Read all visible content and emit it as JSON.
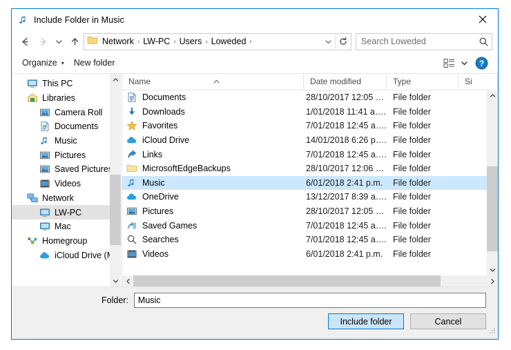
{
  "window": {
    "title": "Include Folder in Music",
    "title_icon": "music-note-icon",
    "close_label": "✕"
  },
  "nav": {
    "back_icon": "←",
    "forward_icon": "→",
    "recent_icon": "⌄",
    "up_icon": "↑",
    "breadcrumbs": [
      "Network",
      "LW-PC",
      "Users",
      "Loweded"
    ],
    "separator": "›",
    "dropdown_icon": "⌄",
    "refresh_icon": "↻"
  },
  "search": {
    "placeholder": "Search Loweded",
    "icon": "search-icon"
  },
  "toolbar": {
    "organize_label": "Organize",
    "organize_caret": "▾",
    "new_folder_label": "New folder",
    "view_icon": "view-list-icon",
    "view_caret": "▾",
    "help_label": "?"
  },
  "sidebar": {
    "items": [
      {
        "label": "This PC",
        "icon": "monitor-icon",
        "depth": 0,
        "selected": false
      },
      {
        "label": "Libraries",
        "icon": "library-icon",
        "depth": 0,
        "selected": false
      },
      {
        "label": "Camera Roll",
        "icon": "camera-roll-icon",
        "depth": 1,
        "selected": false
      },
      {
        "label": "Documents",
        "icon": "documents-icon",
        "depth": 1,
        "selected": false
      },
      {
        "label": "Music",
        "icon": "music-note-icon",
        "depth": 1,
        "selected": false
      },
      {
        "label": "Pictures",
        "icon": "pictures-icon",
        "depth": 1,
        "selected": false
      },
      {
        "label": "Saved Pictures",
        "icon": "saved-pictures-icon",
        "depth": 1,
        "selected": false
      },
      {
        "label": "Videos",
        "icon": "videos-icon",
        "depth": 1,
        "selected": false
      },
      {
        "label": "Network",
        "icon": "network-icon",
        "depth": 0,
        "selected": false
      },
      {
        "label": "LW-PC",
        "icon": "computer-icon",
        "depth": 1,
        "selected": true
      },
      {
        "label": "Mac",
        "icon": "computer-icon",
        "depth": 1,
        "selected": false
      },
      {
        "label": "Homegroup",
        "icon": "homegroup-icon",
        "depth": 0,
        "selected": false
      },
      {
        "label": "iCloud Drive (M·",
        "icon": "icloud-icon",
        "depth": 1,
        "selected": false
      }
    ],
    "scroll_up_icon": "⌃",
    "scroll_down_icon": "⌄"
  },
  "filelist": {
    "columns": [
      {
        "label": "Name",
        "sorted": true,
        "sort_caret": "⌃"
      },
      {
        "label": "Date modified",
        "sorted": false
      },
      {
        "label": "Type",
        "sorted": false
      },
      {
        "label": "Si",
        "sorted": false
      }
    ],
    "rows": [
      {
        "name": "Documents",
        "icon": "documents-icon",
        "date": "28/10/2017 12:05 …",
        "type": "File folder",
        "selected": false
      },
      {
        "name": "Downloads",
        "icon": "downloads-icon",
        "date": "1/01/2018 11:41 a….",
        "type": "File folder",
        "selected": false
      },
      {
        "name": "Favorites",
        "icon": "star-icon",
        "date": "7/01/2018 12:45 a….",
        "type": "File folder",
        "selected": false
      },
      {
        "name": "iCloud Drive",
        "icon": "icloud-icon",
        "date": "14/01/2018 6:26 p….",
        "type": "File folder",
        "selected": false
      },
      {
        "name": "Links",
        "icon": "links-icon",
        "date": "7/01/2018 12:45 a….",
        "type": "File folder",
        "selected": false
      },
      {
        "name": "MicrosoftEdgeBackups",
        "icon": "folder-icon",
        "date": "28/10/2017 12:06 …",
        "type": "File folder",
        "selected": false
      },
      {
        "name": "Music",
        "icon": "music-note-icon",
        "date": "6/01/2018 2:41 p.m.",
        "type": "File folder",
        "selected": true
      },
      {
        "name": "OneDrive",
        "icon": "onedrive-icon",
        "date": "13/12/2017 8:39 a….",
        "type": "File folder",
        "selected": false
      },
      {
        "name": "Pictures",
        "icon": "pictures-icon",
        "date": "28/10/2017 12:05 …",
        "type": "File folder",
        "selected": false
      },
      {
        "name": "Saved Games",
        "icon": "saved-games-icon",
        "date": "7/01/2018 12:45 a….",
        "type": "File folder",
        "selected": false
      },
      {
        "name": "Searches",
        "icon": "search-icon",
        "date": "7/01/2018 12:45 a….",
        "type": "File folder",
        "selected": false
      },
      {
        "name": "Videos",
        "icon": "videos-icon",
        "date": "6/01/2018 2:41 p.m.",
        "type": "File folder",
        "selected": false
      }
    ],
    "hscroll_left_icon": "‹",
    "hscroll_right_icon": "›",
    "vscroll_up_icon": "⌃",
    "vscroll_down_icon": "⌄"
  },
  "footer": {
    "folder_label": "Folder:",
    "folder_value": "Music",
    "include_button": "Include folder",
    "cancel_button": "Cancel"
  },
  "colors": {
    "accent": "#0078d7",
    "selection": "#cce8ff",
    "tree_selection": "#e2e2e2"
  }
}
